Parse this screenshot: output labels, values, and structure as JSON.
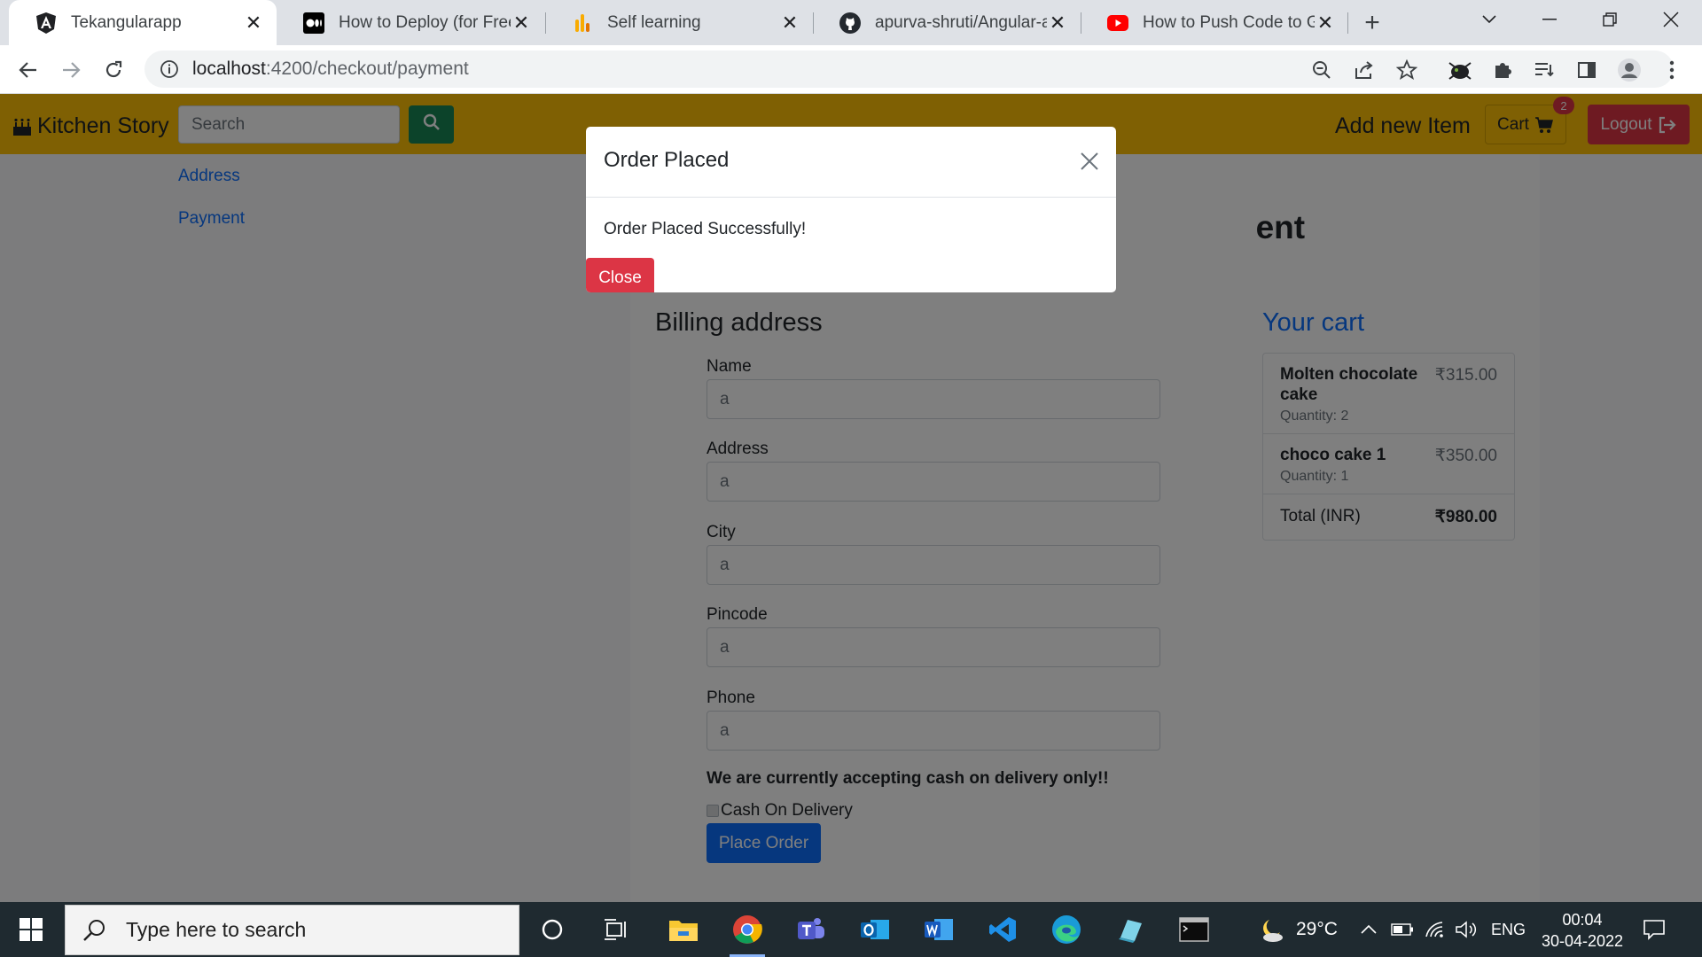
{
  "browser": {
    "tabs": [
      {
        "title": "Tekangularapp",
        "icon": "angular-icon",
        "active": true
      },
      {
        "title": "How to Deploy (for Free) a",
        "icon": "medium-icon",
        "active": false
      },
      {
        "title": "Self learning",
        "icon": "analytics-icon",
        "active": false
      },
      {
        "title": "apurva-shruti/Angular-ap",
        "icon": "github-icon",
        "active": false
      },
      {
        "title": "How to Push Code to Gith",
        "icon": "youtube-icon",
        "active": false
      }
    ],
    "url_host": "localhost",
    "url_path": ":4200/checkout/payment"
  },
  "navbar": {
    "brand": "Kitchen Story",
    "search_placeholder": "Search",
    "add_item": "Add new Item",
    "cart_label": "Cart",
    "cart_count": "2",
    "logout_label": "Logout"
  },
  "sidebar": {
    "links": [
      "Address",
      "Payment"
    ]
  },
  "checkout": {
    "heading_fragment": "ent",
    "billing_title": "Billing address",
    "fields": [
      {
        "label": "Name",
        "value": "a"
      },
      {
        "label": "Address",
        "value": "a"
      },
      {
        "label": "City",
        "value": "a"
      },
      {
        "label": "Pincode",
        "value": "a"
      },
      {
        "label": "Phone",
        "value": "a"
      }
    ],
    "cod_note": "We are currently accepting cash on delivery only!!",
    "cod_label": "Cash On Delivery",
    "place_order": "Place Order"
  },
  "cart": {
    "title": "Your cart",
    "items": [
      {
        "name": "Molten chocolate cake",
        "quantity": "Quantity: 2",
        "price": "₹315.00"
      },
      {
        "name": "choco cake 1",
        "quantity": "Quantity: 1",
        "price": "₹350.00"
      }
    ],
    "total_label": "Total (INR)",
    "total_value": "₹980.00"
  },
  "modal": {
    "title": "Order Placed",
    "message": "Order Placed Successfully!",
    "close_label": "Close"
  },
  "taskbar": {
    "search_placeholder": "Type here to search",
    "weather": "29°C",
    "language": "ENG",
    "time": "00:04",
    "date": "30-04-2022"
  },
  "colors": {
    "warning": "#ffc107",
    "danger": "#dc3545",
    "primary": "#0d6efd",
    "success": "#198754"
  }
}
